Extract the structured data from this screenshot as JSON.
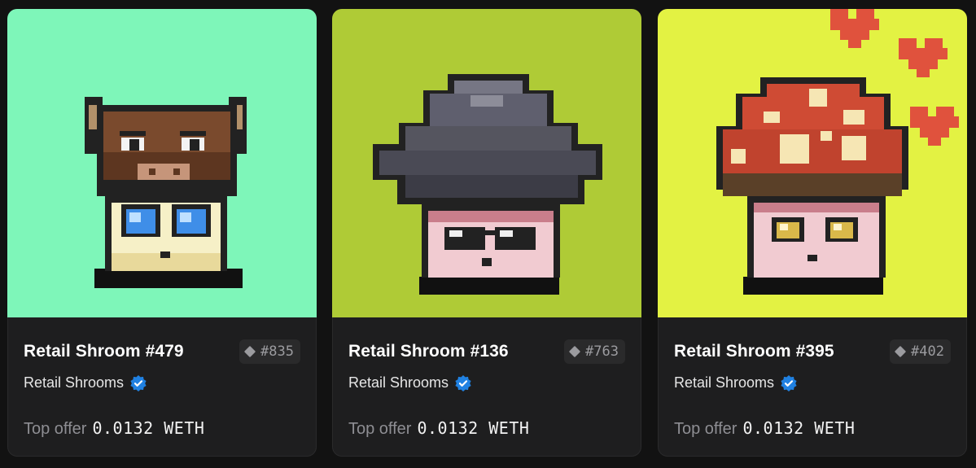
{
  "colors": {
    "page_bg": "#121212",
    "card_bg": "#1e1e1f",
    "verified_blue": "#2081e2"
  },
  "cards": [
    {
      "title": "Retail Shroom #479",
      "rank": "#835",
      "collection": "Retail Shrooms",
      "offer_label": "Top offer",
      "offer_value": "0.0132 WETH",
      "art_bg": "#7ef6b9",
      "icon": "diamond-rank-icon"
    },
    {
      "title": "Retail Shroom #136",
      "rank": "#763",
      "collection": "Retail Shrooms",
      "offer_label": "Top offer",
      "offer_value": "0.0132 WETH",
      "art_bg": "#afcb36",
      "icon": "diamond-rank-icon"
    },
    {
      "title": "Retail Shroom #395",
      "rank": "#402",
      "collection": "Retail Shrooms",
      "offer_label": "Top offer",
      "offer_value": "0.0132 WETH",
      "art_bg": "#e3f243",
      "icon": "diamond-rank-icon"
    }
  ]
}
